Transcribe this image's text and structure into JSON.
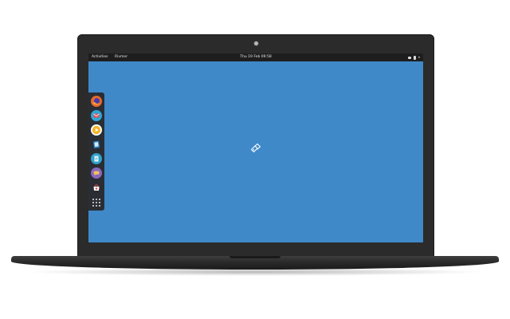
{
  "topbar": {
    "activities_label": "Activities",
    "app_menu_label": "Rivmer",
    "clock_label": "Thu 19 Feb 09:58"
  },
  "dock": {
    "items": [
      {
        "name": "Firefox",
        "icon": "firefox-icon",
        "color": "#e66a2c"
      },
      {
        "name": "Mail",
        "icon": "mail-icon",
        "color": "#2ea6d8"
      },
      {
        "name": "Music player",
        "icon": "music-player-icon",
        "color": "#f6b428"
      },
      {
        "name": "Files",
        "icon": "files-icon",
        "color": "#2f8bd1"
      },
      {
        "name": "Office",
        "icon": "document-icon",
        "color": "#2fa3c9"
      },
      {
        "name": "Chat",
        "icon": "chat-icon",
        "color": "#8a69bd"
      },
      {
        "name": "Store",
        "icon": "store-icon",
        "color": "#2b3a74"
      }
    ],
    "show_apps_icon": "app-grid-icon"
  },
  "desktop": {
    "background_color": "#3f89c9",
    "logo_icon": "distro-logo-icon"
  }
}
